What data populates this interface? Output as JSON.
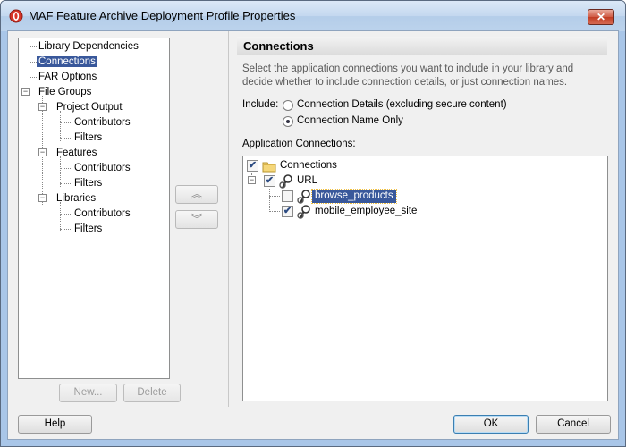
{
  "window": {
    "title": "MAF Feature Archive Deployment Profile Properties",
    "close_glyph": "✕"
  },
  "tree": {
    "items": [
      {
        "label": "Library Dependencies"
      },
      {
        "label": "Connections",
        "selected": true
      },
      {
        "label": "FAR Options"
      },
      {
        "label": "File Groups"
      },
      {
        "label": "Project Output"
      },
      {
        "label": "Contributors"
      },
      {
        "label": "Filters"
      },
      {
        "label": "Features"
      },
      {
        "label": "Contributors"
      },
      {
        "label": "Filters"
      },
      {
        "label": "Libraries"
      },
      {
        "label": "Contributors"
      },
      {
        "label": "Filters"
      }
    ],
    "new_button": "New...",
    "delete_button": "Delete"
  },
  "move": {
    "up_glyph": "︽",
    "down_glyph": "︾"
  },
  "main": {
    "section_title": "Connections",
    "instructions": "Select the application connections you want to include in your library and decide whether to include connection details, or just connection names.",
    "include_label": "Include:",
    "options": [
      {
        "label": "Connection Details (excluding secure content)",
        "checked": false
      },
      {
        "label": "Connection Name Only",
        "checked": true
      }
    ],
    "app_connections_label": "Application Connections:",
    "connections_tree": {
      "root": "Connections",
      "group": "URL",
      "items": [
        {
          "label": "browse_products",
          "checked": false,
          "selected": true
        },
        {
          "label": "mobile_employee_site",
          "checked": true
        }
      ]
    }
  },
  "footer": {
    "help_button": "Help",
    "ok_button": "OK",
    "cancel_button": "Cancel"
  },
  "colors": {
    "selection": "#39589b",
    "title_bar": "#c4d8ef",
    "close_button": "#c13c23"
  }
}
